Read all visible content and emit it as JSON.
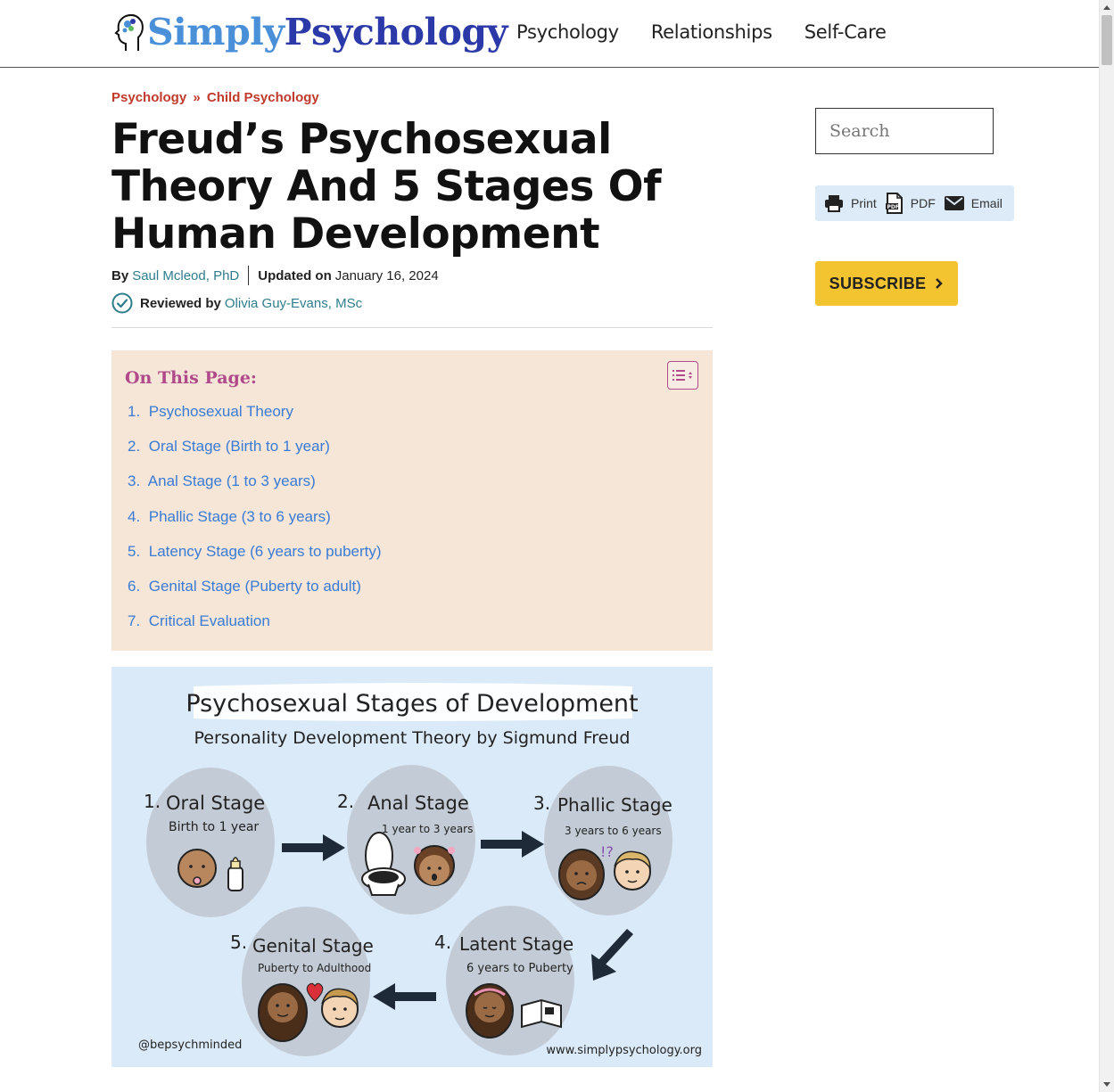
{
  "header": {
    "logo_simply": "Simply",
    "logo_psychology": "Psychology",
    "nav": [
      "Psychology",
      "Relationships",
      "Self-Care"
    ]
  },
  "breadcrumb": {
    "parent": "Psychology",
    "separator": "»",
    "current": "Child Psychology"
  },
  "article": {
    "title": "Freud’s Psychosexual Theory And 5 Stages Of Human Development",
    "by_label": "By",
    "author": "Saul Mcleod, PhD",
    "updated_label": "Updated on",
    "updated_date": "January 16, 2024",
    "reviewed_label": "Reviewed by",
    "reviewer": "Olivia Guy-Evans, MSc"
  },
  "toc": {
    "title": "On This Page:",
    "items": [
      {
        "num": "1.",
        "label": "Psychosexual Theory"
      },
      {
        "num": "2.",
        "label": "Oral Stage (Birth to 1 year)"
      },
      {
        "num": "3.",
        "label": "Anal Stage (1 to 3 years)"
      },
      {
        "num": "4.",
        "label": "Phallic Stage (3 to 6 years)"
      },
      {
        "num": "5.",
        "label": "Latency Stage (6 years to puberty)"
      },
      {
        "num": "6.",
        "label": "Genital Stage (Puberty to adult)"
      },
      {
        "num": "7.",
        "label": "Critical Evaluation"
      }
    ]
  },
  "infographic": {
    "title": "Psychosexual Stages of Development",
    "subtitle": "Personality Development Theory by Sigmund Freud",
    "stages": [
      {
        "num": "1.",
        "name": "Oral Stage",
        "age": "Birth to 1 year"
      },
      {
        "num": "2.",
        "name": "Anal Stage",
        "age": "1 year to 3 years"
      },
      {
        "num": "3.",
        "name": "Phallic Stage",
        "age": "3 years to 6 years"
      },
      {
        "num": "4.",
        "name": "Latent Stage",
        "age": "6 years to Puberty"
      },
      {
        "num": "5.",
        "name": "Genital Stage",
        "age": "Puberty to Adulthood"
      }
    ],
    "credit_left": "@bepsychminded",
    "credit_right": "www.simplypsychology.org",
    "exclaim": "!?"
  },
  "sidebar": {
    "search_placeholder": "Search",
    "share": {
      "print": "Print",
      "pdf": "PDF",
      "email": "Email"
    },
    "subscribe": "SUBSCRIBE"
  },
  "colors": {
    "accent_red": "#c0392b",
    "link_teal": "#2f7d8c",
    "toc_bg": "#f5e6d8",
    "toc_title": "#b04a8a",
    "toc_link": "#3a7bd5",
    "subscribe_bg": "#f4c430"
  }
}
